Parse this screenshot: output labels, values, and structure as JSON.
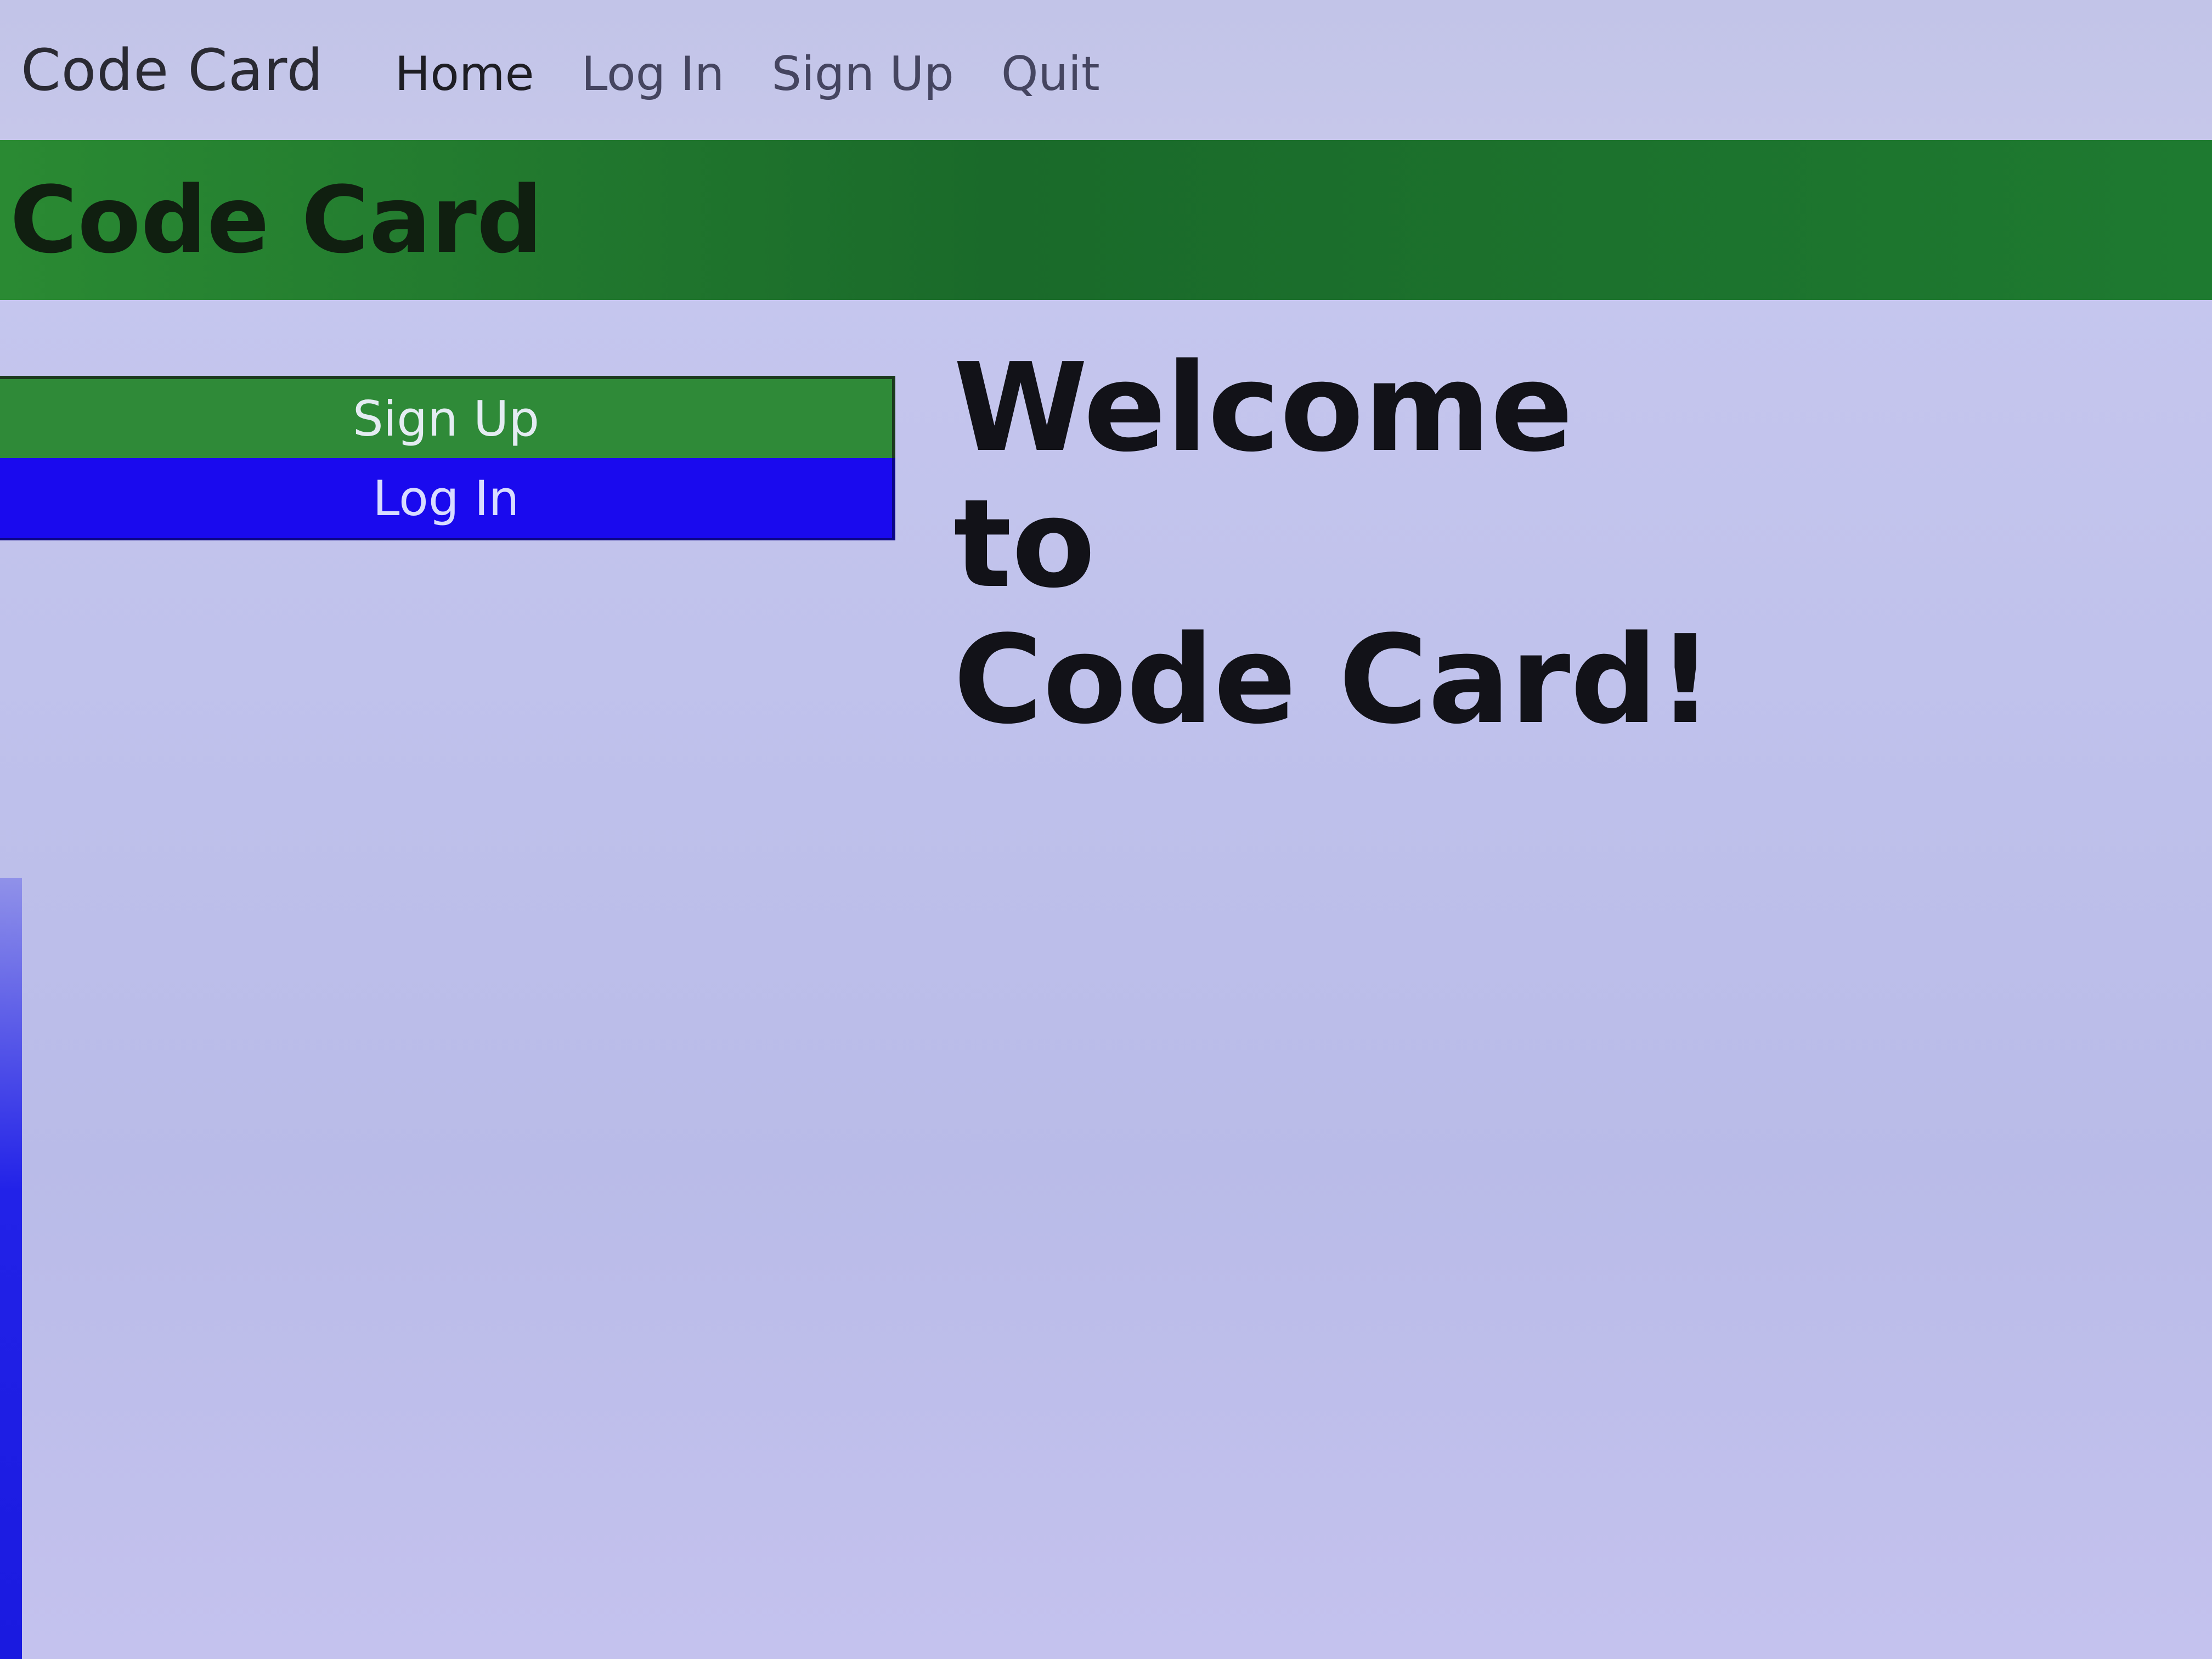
{
  "navbar": {
    "brand": "Code Card",
    "links": [
      {
        "label": "Home"
      },
      {
        "label": "Log In"
      },
      {
        "label": "Sign Up"
      },
      {
        "label": "Quit"
      }
    ]
  },
  "banner": {
    "title": "Code Card"
  },
  "side_menu": {
    "signup_label": "Sign Up",
    "login_label": "Log In"
  },
  "main": {
    "welcome_line1": "Welcome to",
    "welcome_line2": "Code Card!"
  },
  "colors": {
    "banner_green": "#1e7a30",
    "signup_green": "#2f8a38",
    "login_blue": "#1a0aee",
    "background": "#c0c2ec"
  }
}
